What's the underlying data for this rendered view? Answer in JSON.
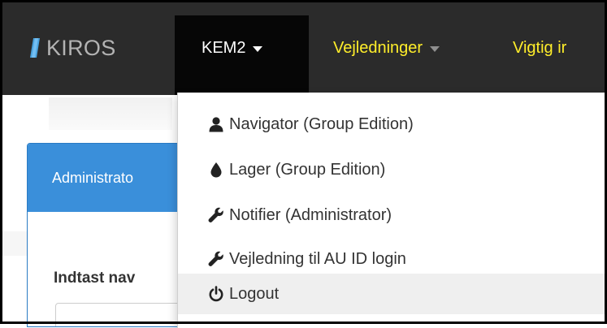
{
  "navbar": {
    "brand": {
      "name": "KIROS"
    },
    "items": [
      {
        "label": "KEM2",
        "active": true
      },
      {
        "label": "Vejledninger"
      },
      {
        "label": "Vigtig ir"
      }
    ],
    "colors": {
      "background": "#2b2b2b",
      "active_background": "#060606",
      "link": "#ffee2a",
      "brand_text": "#b3b3b3"
    }
  },
  "dropdown": {
    "items": [
      {
        "label": "Navigator (Group Edition)",
        "icon": "user-icon"
      },
      {
        "label": "Lager (Group Edition)",
        "icon": "tint-icon"
      },
      {
        "label": "Notifier (Administrator)",
        "icon": "wrench-icon"
      },
      {
        "label": "Vejledning til AU ID login",
        "icon": "wrench-icon"
      },
      {
        "label": "Logout",
        "icon": "power-icon",
        "hovered": true
      }
    ]
  },
  "page": {
    "panel_heading": "Administrato",
    "field_label": "Indtast nav",
    "accent_color": "#3a8fda"
  }
}
